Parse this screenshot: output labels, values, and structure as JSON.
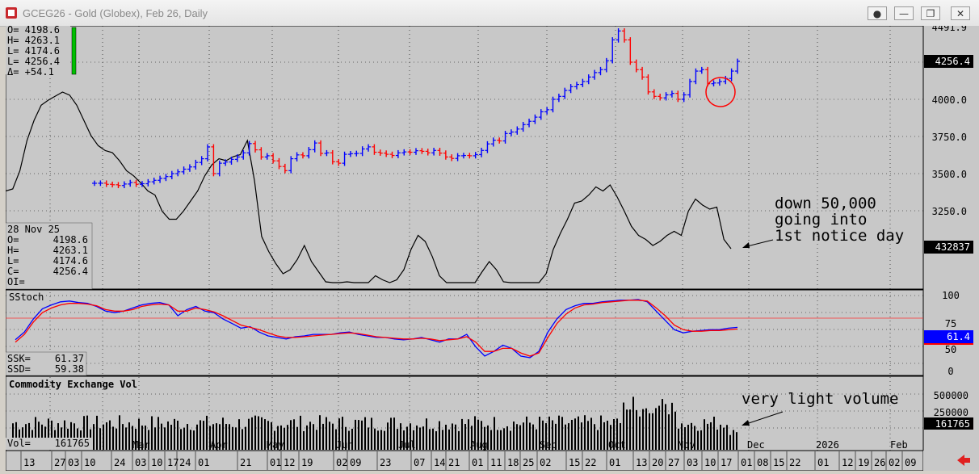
{
  "window": {
    "title": "GCEG26 - Gold (Globex), Feb 26, Daily",
    "buttons": [
      "●",
      "—",
      "❐",
      "✕"
    ]
  },
  "colors": {
    "background": "#c8c8c8",
    "up_bars": "#0000ff",
    "down_bars": "#ff0000",
    "oi_line": "#000000",
    "annotation_circle": "#ff0000",
    "ssk": "#0000ff",
    "ssd": "#ff0000",
    "volume": "#000000"
  },
  "ohlc_box": {
    "lines": [
      "O=  4198.6",
      "H=  4263.1",
      "L=  4174.6",
      "L=  4256.4",
      "Δ=   +54.1"
    ]
  },
  "data_window": {
    "date": "28 Nov 25",
    "rows": [
      {
        "k": "O=",
        "v": "4198.6"
      },
      {
        "k": "H=",
        "v": "4263.1"
      },
      {
        "k": "L=",
        "v": "4174.6"
      },
      {
        "k": "C=",
        "v": "4256.4"
      },
      {
        "k": "OI=",
        "v": ""
      }
    ]
  },
  "chart_data": [
    {
      "type": "ohlc",
      "title": "",
      "ylim": [
        3050,
        4500
      ],
      "y_ticks": [
        "3250.0",
        "3500.0",
        "3750.0",
        "4000.0"
      ],
      "last_price_label": "4256.4",
      "top_label": "4491.9",
      "oi_label": "432837",
      "price_closes": [
        3435,
        3436,
        3428,
        3425,
        3420,
        3430,
        3440,
        3428,
        3432,
        3445,
        3455,
        3468,
        3480,
        3500,
        3512,
        3530,
        3545,
        3575,
        3600,
        3680,
        3500,
        3570,
        3578,
        3596,
        3612,
        3640,
        3702,
        3660,
        3612,
        3620,
        3586,
        3548,
        3520,
        3600,
        3626,
        3620,
        3661,
        3706,
        3636,
        3640,
        3580,
        3570,
        3630,
        3634,
        3636,
        3666,
        3680,
        3644,
        3638,
        3630,
        3622,
        3640,
        3646,
        3644,
        3654,
        3650,
        3640,
        3656,
        3638,
        3612,
        3602,
        3620,
        3622,
        3620,
        3628,
        3656,
        3700,
        3725,
        3720,
        3770,
        3780,
        3800,
        3830,
        3852,
        3880,
        3916,
        3930,
        4000,
        4020,
        4060,
        4085,
        4100,
        4120,
        4150,
        4180,
        4200,
        4260,
        4400,
        4460,
        4400,
        4250,
        4200,
        4150,
        4050,
        4020,
        4010,
        4030,
        4040,
        4000,
        4030,
        4120,
        4190,
        4200,
        4105,
        4110,
        4120,
        4140,
        4190,
        4256
      ],
      "oi_line_values": [
        490000,
        492000,
        510000,
        540000,
        560000,
        575000,
        580000,
        584000,
        588000,
        585000,
        575000,
        560000,
        545000,
        535000,
        530000,
        528000,
        520000,
        510000,
        505000,
        498000,
        490000,
        486000,
        470000,
        462000,
        462000,
        470000,
        480000,
        490000,
        505000,
        516000,
        522000,
        520000,
        524000,
        526000,
        540000,
        500000,
        445000,
        430000,
        418000,
        408000,
        412000,
        422000,
        436000,
        420000,
        410000,
        400000,
        396000,
        396000,
        400000,
        396000,
        392000,
        398000,
        406000,
        402000,
        398000,
        402000,
        412000,
        432000,
        446000,
        440000,
        425000,
        406000,
        398000,
        392000,
        388000,
        390000,
        396000,
        410000,
        420000,
        412000,
        400000,
        392000,
        380000,
        380000,
        386000,
        396000,
        408000,
        432000,
        448000,
        462000,
        478000,
        480000,
        486000,
        494000,
        490000,
        496000,
        484000,
        470000,
        455000,
        446000,
        442000,
        436000,
        440000,
        446000,
        450000,
        446000,
        470000,
        482000,
        476000,
        472000,
        474000,
        442000,
        432837
      ],
      "annotations": [
        "down 50,000",
        "going into",
        "1st notice day"
      ],
      "x_month_labels": [
        "Mar",
        "Apr",
        "May",
        "Jun",
        "Jul",
        "Aug",
        "Sep",
        "Oct",
        "Nov",
        "Dec",
        "2026",
        "Feb"
      ],
      "x_day_labels": [
        "13",
        "27",
        "03",
        "10",
        "24",
        "03",
        "10",
        "17",
        "24",
        "01",
        "21",
        "01",
        "12",
        "19",
        "02",
        "09",
        "23",
        "07",
        "14",
        "21",
        "01",
        "11",
        "18",
        "25",
        "02",
        "15",
        "22",
        "01",
        "13",
        "20",
        "27",
        "03",
        "10",
        "17",
        "01",
        "08",
        "15",
        "22",
        "01",
        "12",
        "19",
        "26",
        "02",
        "09"
      ]
    },
    {
      "type": "line",
      "title": "SStoch",
      "ylim": [
        0,
        100
      ],
      "y_ticks": [
        "100",
        "75",
        "50",
        "0"
      ],
      "last_value_label": "61.4",
      "series": [
        {
          "name": "SSK",
          "current": "61.37",
          "values": [
            45,
            55,
            72,
            85,
            90,
            94,
            95,
            93,
            92,
            88,
            82,
            80,
            82,
            86,
            90,
            92,
            93,
            90,
            76,
            84,
            88,
            82,
            80,
            72,
            66,
            60,
            62,
            55,
            50,
            48,
            46,
            49,
            50,
            52,
            52,
            52,
            54,
            55,
            52,
            50,
            48,
            48,
            46,
            45,
            46,
            48,
            45,
            42,
            46,
            46,
            52,
            36,
            24,
            30,
            38,
            34,
            24,
            22,
            30,
            55,
            72,
            84,
            89,
            92,
            92,
            94,
            95,
            96,
            96,
            97,
            94,
            82,
            70,
            58,
            54,
            56,
            57,
            58,
            58,
            60,
            61
          ]
        },
        {
          "name": "SSD",
          "current": "59.38",
          "values": [
            42,
            52,
            68,
            80,
            86,
            90,
            92,
            92,
            91,
            89,
            84,
            82,
            82,
            84,
            88,
            90,
            91,
            90,
            82,
            82,
            86,
            84,
            81,
            76,
            70,
            64,
            61,
            58,
            54,
            50,
            48,
            48,
            49,
            50,
            51,
            52,
            53,
            54,
            53,
            51,
            49,
            48,
            47,
            46,
            46,
            47,
            46,
            44,
            45,
            46,
            49,
            42,
            30,
            30,
            34,
            34,
            28,
            24,
            28,
            48,
            66,
            78,
            86,
            90,
            91,
            93,
            94,
            95,
            96,
            96,
            95,
            86,
            76,
            64,
            58,
            56,
            56,
            57,
            57,
            58,
            59
          ]
        }
      ],
      "reference_line": 80
    },
    {
      "type": "bar",
      "title": "Commodity Exchange Vol",
      "ylim": [
        0,
        600000
      ],
      "y_ticks": [
        "500000",
        "250000"
      ],
      "last_value_label": "161765",
      "current_label": "Vol=",
      "current_value": "161765",
      "annotation": "very light volume"
    }
  ]
}
